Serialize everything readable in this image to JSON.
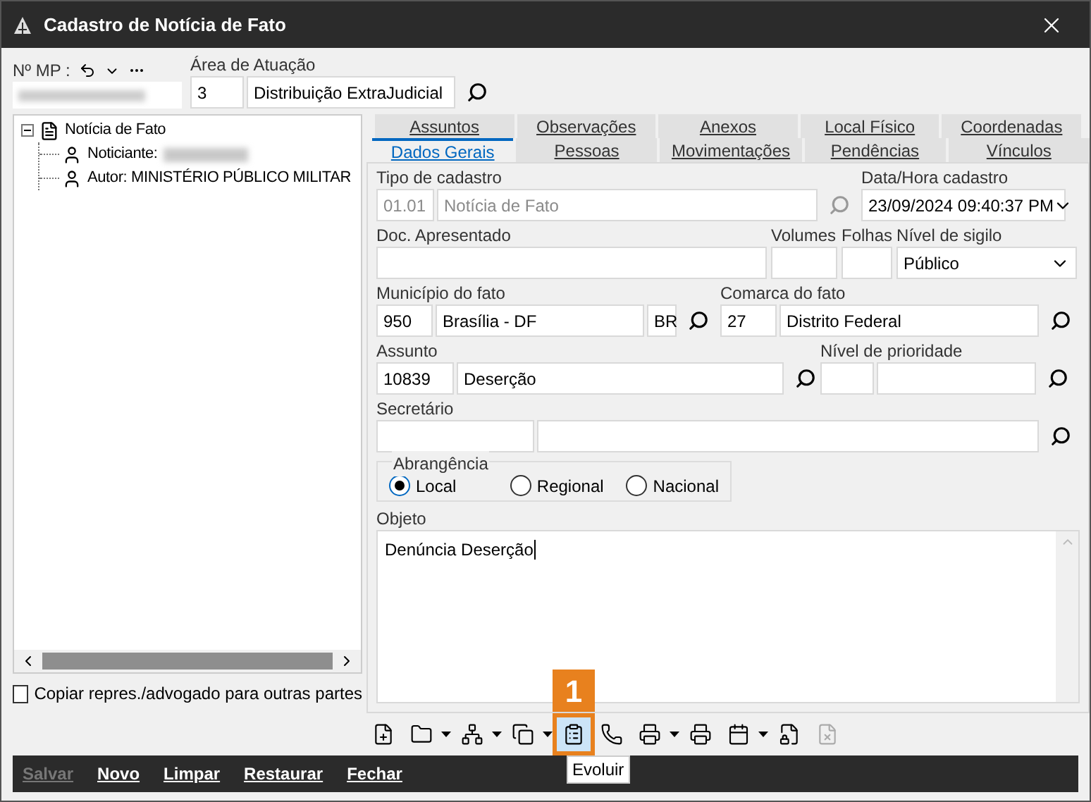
{
  "window": {
    "title": "Cadastro de Notícia de Fato"
  },
  "header": {
    "mp_label": "Nº MP :",
    "area_label": "Área de Atuação",
    "area_code": "3",
    "area_name": "Distribuição ExtraJudicial"
  },
  "tree": [
    {
      "label": "Notícia de Fato",
      "kind": "document",
      "expanded": true,
      "children": [
        {
          "label": "Noticiante:",
          "kind": "person",
          "redacted": true
        },
        {
          "label": "Autor: MINISTÉRIO PÚBLICO MILITAR",
          "kind": "person",
          "redacted": false
        }
      ]
    }
  ],
  "copy_checkbox": {
    "label": "Copiar repres./advogado para outras partes",
    "checked": false
  },
  "tab_rows": [
    [
      {
        "label": "Assuntos",
        "selected": false
      },
      {
        "label": "Observações",
        "selected": false
      },
      {
        "label": "Anexos",
        "selected": false
      },
      {
        "label": "Local Físico",
        "selected": false
      },
      {
        "label": "Coordenadas",
        "selected": false
      }
    ],
    [
      {
        "label": "Dados Gerais",
        "selected": true
      },
      {
        "label": "Pessoas",
        "selected": false
      },
      {
        "label": "Movimentações",
        "selected": false
      },
      {
        "label": "Pendências",
        "selected": false
      },
      {
        "label": "Vínculos",
        "selected": false
      }
    ]
  ],
  "form": {
    "tipo": {
      "label": "Tipo de cadastro",
      "code": "01.01",
      "name": "Notícia de Fato",
      "disabled": true
    },
    "data_hora": {
      "label": "Data/Hora cadastro",
      "value": "23/09/2024 09:40:37 PM"
    },
    "doc": {
      "label": "Doc. Apresentado"
    },
    "volumes": {
      "label": "Volumes"
    },
    "folhas": {
      "label": "Folhas"
    },
    "sigilo": {
      "label": "Nível de sigilo",
      "value": "Público"
    },
    "municipio": {
      "label": "Município do fato",
      "code": "950",
      "name": "Brasília - DF",
      "uf": "BR"
    },
    "comarca": {
      "label": "Comarca do fato",
      "code": "27",
      "name": "Distrito Federal"
    },
    "assunto": {
      "label": "Assunto",
      "code": "10839",
      "name": "Deserção"
    },
    "prioridade": {
      "label": "Nível de prioridade"
    },
    "secretario": {
      "label": "Secretário"
    },
    "abrangencia": {
      "label": "Abrangência",
      "options": [
        {
          "label": "Local",
          "selected": true
        },
        {
          "label": "Regional",
          "selected": false
        },
        {
          "label": "Nacional",
          "selected": false
        }
      ]
    },
    "objeto": {
      "label": "Objeto",
      "value": "Denúncia Deserção"
    }
  },
  "toolbar": [
    {
      "kind": "new-doc",
      "dropdown": false,
      "highlighted": false,
      "disabled": false
    },
    {
      "kind": "folder",
      "dropdown": true,
      "highlighted": false,
      "disabled": false
    },
    {
      "kind": "tree",
      "dropdown": true,
      "highlighted": false,
      "disabled": false
    },
    {
      "kind": "copy-arrow",
      "dropdown": true,
      "highlighted": false,
      "disabled": false
    },
    {
      "kind": "evolve",
      "dropdown": false,
      "highlighted": true,
      "disabled": false
    },
    {
      "kind": "phone",
      "dropdown": false,
      "highlighted": false,
      "disabled": false
    },
    {
      "kind": "printer",
      "dropdown": true,
      "highlighted": false,
      "disabled": false
    },
    {
      "kind": "small-printer",
      "dropdown": false,
      "highlighted": false,
      "disabled": false
    },
    {
      "kind": "calendar",
      "dropdown": true,
      "highlighted": false,
      "disabled": false
    },
    {
      "kind": "doc-lock",
      "dropdown": false,
      "highlighted": false,
      "disabled": false
    },
    {
      "kind": "doc-x",
      "dropdown": false,
      "highlighted": false,
      "disabled": true
    }
  ],
  "tooltip": "Evoluir",
  "step_badge": "1",
  "actions": [
    {
      "label": "Salvar",
      "disabled": true
    },
    {
      "label": "Novo",
      "disabled": false
    },
    {
      "label": "Limpar",
      "disabled": false
    },
    {
      "label": "Restaurar",
      "disabled": false
    },
    {
      "label": "Fechar",
      "disabled": false
    }
  ]
}
